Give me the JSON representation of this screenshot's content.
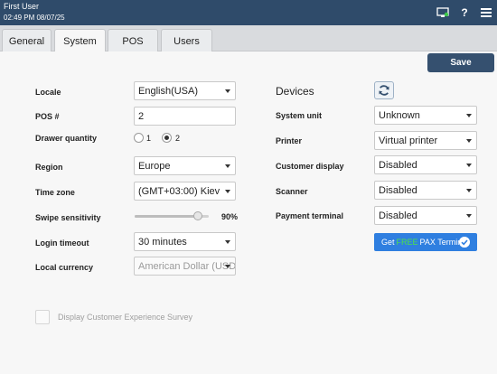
{
  "header": {
    "user": "First User",
    "datetime": "02:49 PM 08/07/25",
    "help_glyph": "?",
    "icons": [
      "monitor-icon",
      "help-icon",
      "hamburger-menu-icon"
    ]
  },
  "tabs": [
    {
      "label": "General",
      "active": false
    },
    {
      "label": "System",
      "active": true
    },
    {
      "label": "POS",
      "active": false
    },
    {
      "label": "Users",
      "active": false
    }
  ],
  "toolbar": {
    "save_label": "Save"
  },
  "settings": {
    "locale": {
      "label": "Locale",
      "value": "English(USA)"
    },
    "pos_number": {
      "label": "POS #",
      "value": "2"
    },
    "drawer_quantity": {
      "label": "Drawer quantity",
      "options": [
        "1",
        "2"
      ],
      "selected": "2"
    },
    "region": {
      "label": "Region",
      "value": "Europe"
    },
    "time_zone": {
      "label": "Time zone",
      "value": "(GMT+03:00) Kiev"
    },
    "swipe_sensitivity": {
      "label": "Swipe sensitivity",
      "value_text": "90%",
      "value": 0.9
    },
    "login_timeout": {
      "label": "Login timeout",
      "value": "30 minutes"
    },
    "local_currency": {
      "label": "Local currency",
      "value": "American Dollar (USD)"
    }
  },
  "devices": {
    "heading": "Devices",
    "system_unit": {
      "label": "System unit",
      "value": "Unknown"
    },
    "printer": {
      "label": "Printer",
      "value": "Virtual printer"
    },
    "customer_display": {
      "label": "Customer display",
      "value": "Disabled"
    },
    "scanner": {
      "label": "Scanner",
      "value": "Disabled"
    },
    "payment_terminal": {
      "label": "Payment terminal",
      "value": "Disabled"
    },
    "pax_button": {
      "prefix": "Get",
      "free": "FREE",
      "suffix": "PAX Terminal"
    }
  },
  "survey": {
    "label": "Display Customer Experience Survey",
    "checked": false
  },
  "colors": {
    "header_bg": "#2f4b6a",
    "save_bg": "#35506f",
    "pax_bg": "#2f7fe0",
    "pax_free": "#4de04d"
  }
}
